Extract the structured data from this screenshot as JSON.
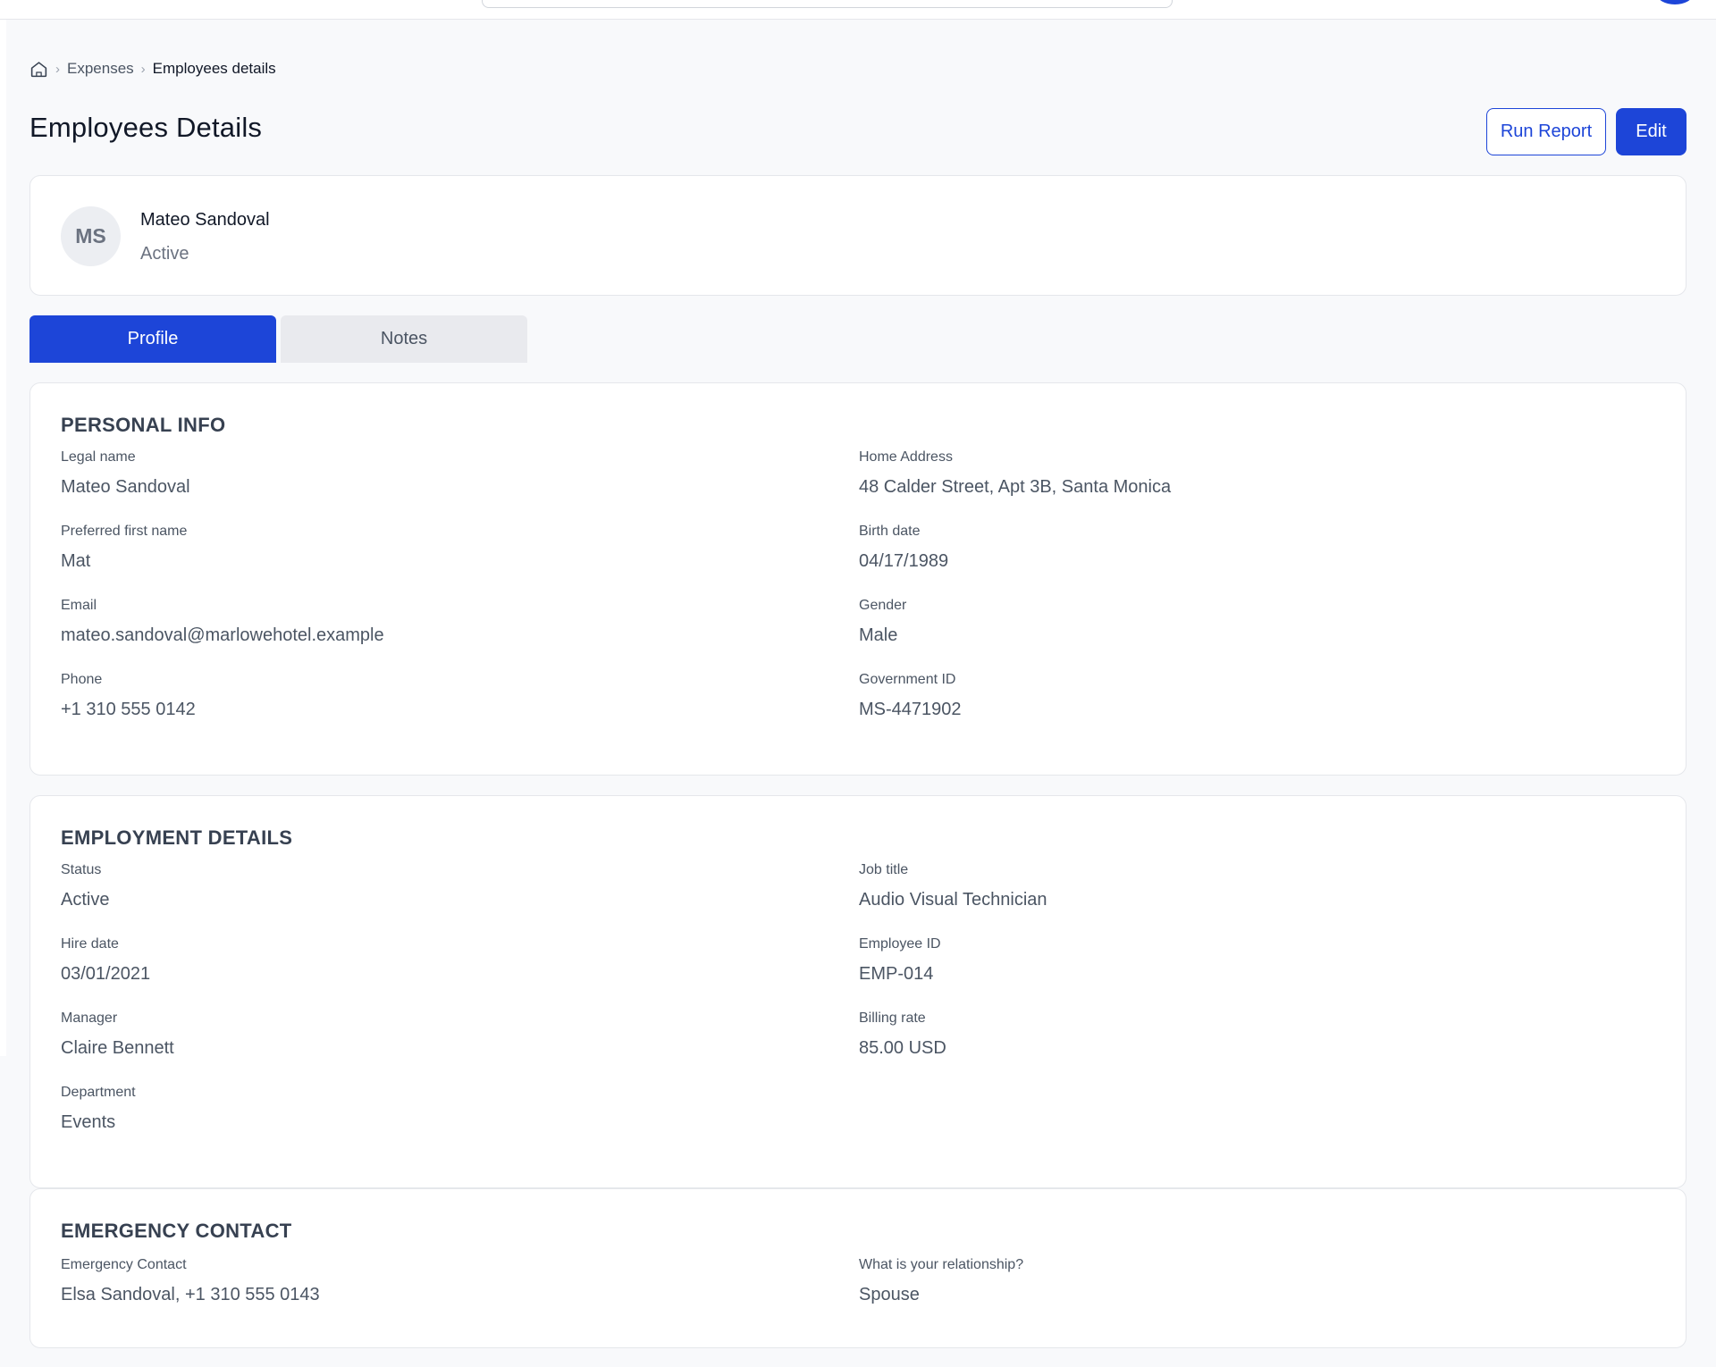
{
  "breadcrumb": {
    "items": [
      "Expenses",
      "Employees details"
    ]
  },
  "page": {
    "title": "Employees Details"
  },
  "actions": {
    "run_report": "Run Report",
    "edit": "Edit"
  },
  "profile": {
    "initials": "MS",
    "name": "Mateo Sandoval",
    "status": "Active"
  },
  "tabs": [
    {
      "label": "Profile",
      "active": true
    },
    {
      "label": "Notes",
      "active": false
    }
  ],
  "personal_info": {
    "title": "PERSONAL INFO",
    "left": [
      {
        "label": "Legal name",
        "value": "Mateo Sandoval"
      },
      {
        "label": "Preferred first name",
        "value": "Mat"
      },
      {
        "label": "Email",
        "value": "mateo.sandoval@marlowehotel.example"
      },
      {
        "label": "Phone",
        "value": "+1 310 555 0142"
      }
    ],
    "right": [
      {
        "label": "Home Address",
        "value": "48 Calder Street, Apt 3B, Santa Monica"
      },
      {
        "label": "Birth date",
        "value": "04/17/1989"
      },
      {
        "label": "Gender",
        "value": "Male"
      },
      {
        "label": "Government ID",
        "value": "MS-4471902"
      }
    ]
  },
  "employment_details": {
    "title": "EMPLOYMENT DETAILS",
    "left": [
      {
        "label": "Status",
        "value": "Active"
      },
      {
        "label": "Hire date",
        "value": "03/01/2021"
      },
      {
        "label": "Manager",
        "value": "Claire Bennett"
      },
      {
        "label": "Department",
        "value": "Events"
      }
    ],
    "right": [
      {
        "label": "Job title",
        "value": "Audio Visual Technician"
      },
      {
        "label": "Employee ID",
        "value": "EMP-014"
      },
      {
        "label": "Billing rate",
        "value": "85.00 USD"
      }
    ]
  },
  "emergency_contact": {
    "title": "EMERGENCY CONTACT",
    "left": [
      {
        "label": "Emergency Contact",
        "value": "Elsa Sandoval, +1 310 555 0143"
      }
    ],
    "right": [
      {
        "label": "What is your relationship?",
        "value": "Spouse"
      }
    ]
  },
  "colors": {
    "accent": "#1d45d8",
    "background": "#f8f9fb",
    "tab_inactive": "#e9eaee"
  },
  "icons": {
    "breadcrumb_home": "home-icon",
    "breadcrumb_separator": "chevron-right-icon"
  }
}
